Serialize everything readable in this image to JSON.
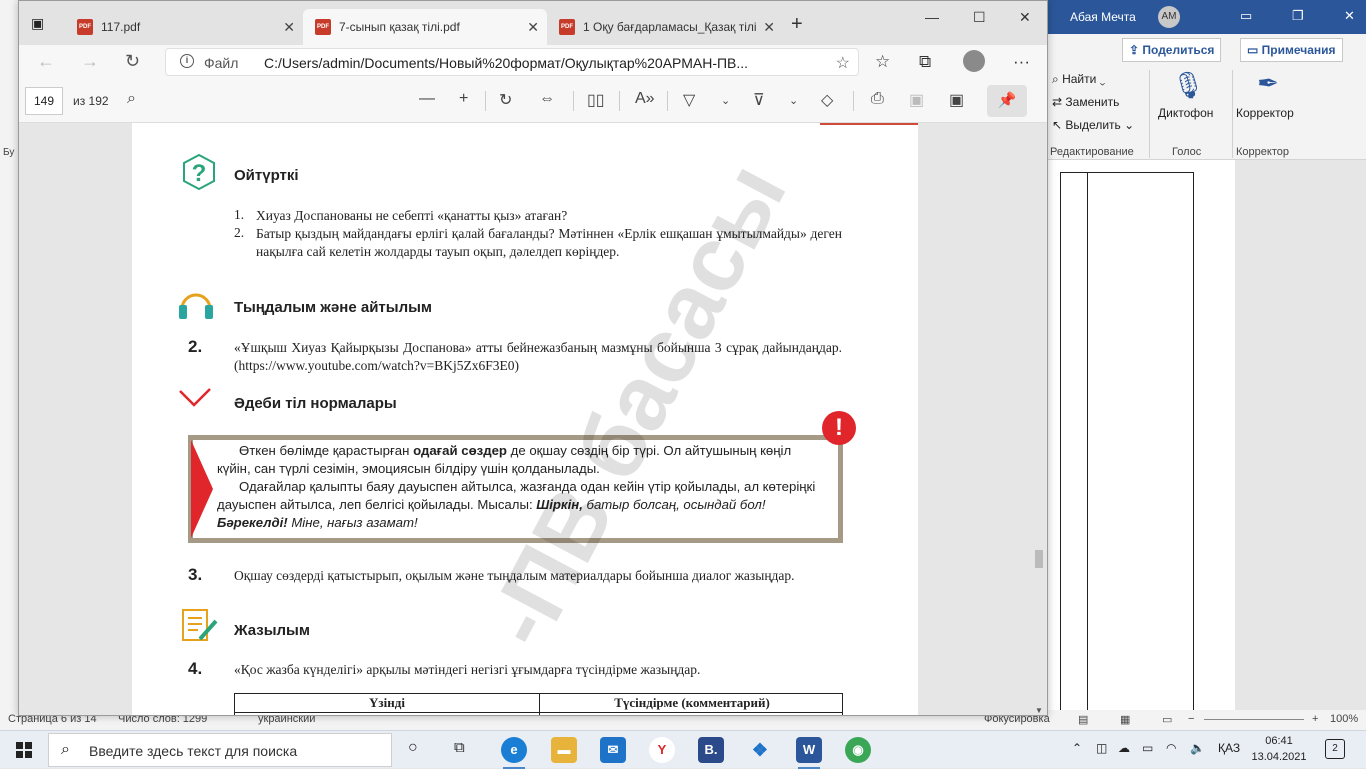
{
  "word": {
    "user_name": "Абая Мечта",
    "user_initials": "AM",
    "share_label": "Поделиться",
    "notes_label": "Примечания",
    "find_label": "Найти",
    "replace_label": "Заменить",
    "select_label": "Выделить",
    "dictation_label": "Диктофон",
    "editor_label": "Корректор",
    "group_editing": "Редактирование",
    "group_voice": "Голос",
    "group_editor": "Корректор",
    "left_partial": "Бу",
    "status_page": "Страница 6 из 14",
    "status_words": "Число слов: 1299",
    "status_lang": "украинский",
    "status_focus": "Фокусировка",
    "zoom": "100%"
  },
  "edge": {
    "tabs": [
      {
        "label": "117.pdf",
        "active": false
      },
      {
        "label": "7-сынып қазақ тілі.pdf",
        "active": true
      },
      {
        "label": "1 Оқу бағдарламасы_Қазақ тілі",
        "active": false
      }
    ],
    "new_tab": "+",
    "url_scheme": "Файл",
    "url": "C:/Users/admin/Documents/Новый%20формат/Оқулықтар%20АРМАН-ПВ...",
    "page_current": "149",
    "page_total": "из 192"
  },
  "pdf": {
    "section1": "Ойтүрткі",
    "q1_num": "1.",
    "q1": "Хиуаз Доспанованы не себепті «қанатты қыз» атаған?",
    "q2_num": "2.",
    "q2": "Батыр қыздың майдандағы ерлігі қалай бағаланды? Мәтіннен «Ерлік ешқашан ұмытылмайды» деген нақылға сай келетін жолдарды тауып оқып, дәлелдеп көріңдер.",
    "section2": "Тыңдалым және айтылым",
    "task2_num": "2.",
    "task2": "«Ұшқыш Хиуаз Қайырқызы Доспанова» атты бейнежазбаның мазмұны бойынша 3 сұрақ дайындаңдар. (https://www.youtube.com/watch?v=BKj5Zx6F3E0)",
    "section3": "Әдеби тіл нормалары",
    "rule_p1_a": "Өткен бөлімде қарастырған ",
    "rule_p1_bold": "одағай сөздер",
    "rule_p1_b": " де оқшау сөздің бір түрі. Ол айтушының көңіл күйін, сан түрлі сезімін, эмоциясын білдіру үшін қолданылады.",
    "rule_p2_a": "Одағайлар қалыпты баяу дауыспен айтылса, жазғанда одан кейін үтір қойылады, ал көтеріңкі дауыспен айтылса, леп белгісі қойылады. Мысалы: ",
    "rule_p2_ex1": "Шіркін,",
    "rule_p2_ex2": " батыр болсаң, осындай бол! ",
    "rule_p2_ex3": "Бәрекелді!",
    "rule_p2_ex4": " Міне, нағыз азамат!",
    "excl": "!",
    "task3_num": "3.",
    "task3": "Оқшау сөздерді қатыстырып, оқылым және тыңдалым материалдары бойынша диалог жазыңдар.",
    "section4": "Жазылым",
    "task4_num": "4.",
    "task4": "«Қос жазба күнделігі» арқылы мәтіндегі негізгі ұғымдарға түсіндірме жазыңдар.",
    "table_col1": "Үзінді",
    "table_col2": "Түсіндірме (комментарий)",
    "watermark": "-ПВ басасы"
  },
  "taskbar": {
    "search_placeholder": "Введите здесь текст для поиска",
    "lang": "ҚАЗ",
    "time": "06:41",
    "date": "13.04.2021",
    "notif_count": "2"
  }
}
